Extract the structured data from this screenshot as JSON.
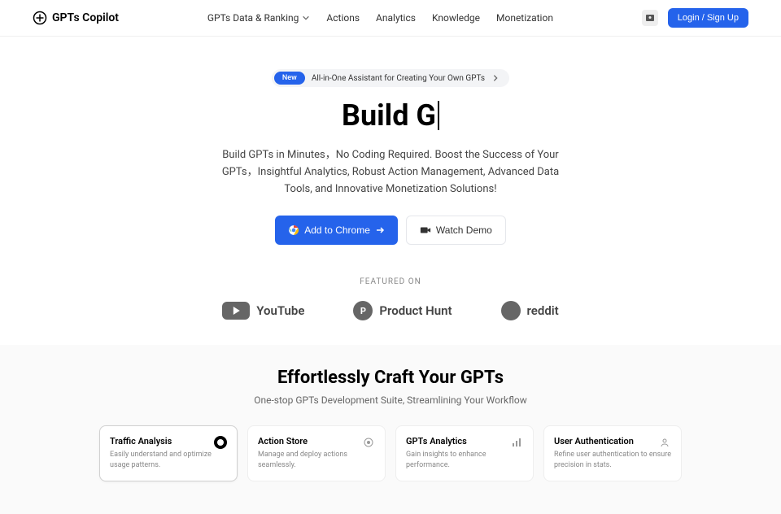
{
  "brand": "GPTs Copilot",
  "nav": {
    "items": [
      {
        "label": "GPTs Data & Ranking",
        "has_dropdown": true
      },
      {
        "label": "Actions",
        "has_dropdown": false
      },
      {
        "label": "Analytics",
        "has_dropdown": false
      },
      {
        "label": "Knowledge",
        "has_dropdown": false
      },
      {
        "label": "Monetization",
        "has_dropdown": false
      }
    ]
  },
  "login_label": "Login / Sign Up",
  "announcement": {
    "badge": "New",
    "text": "All-in-One Assistant for Creating Your Own GPTs"
  },
  "hero": {
    "title": "Build G",
    "description": "Build GPTs in Minutes，No Coding Required. Boost the Success of Your GPTs，Insightful Analytics, Robust Action Management, Advanced Data Tools, and Innovative Monetization Solutions!",
    "primary_cta": "Add to Chrome",
    "secondary_cta": "Watch Demo"
  },
  "featured": {
    "label": "FEATURED ON",
    "logos": [
      "YouTube",
      "Product Hunt",
      "reddit"
    ]
  },
  "section2": {
    "title": "Effortlessly Craft Your GPTs",
    "subtitle": "One-stop GPTs Development Suite, Streamlining Your Workflow",
    "cards": [
      {
        "title": "Traffic Analysis",
        "desc": "Easily understand and optimize usage patterns."
      },
      {
        "title": "Action Store",
        "desc": "Manage and deploy actions seamlessly."
      },
      {
        "title": "GPTs Analytics",
        "desc": "Gain insights to enhance performance."
      },
      {
        "title": "User Authentication",
        "desc": "Refine user authentication to ensure precision in stats."
      }
    ]
  }
}
